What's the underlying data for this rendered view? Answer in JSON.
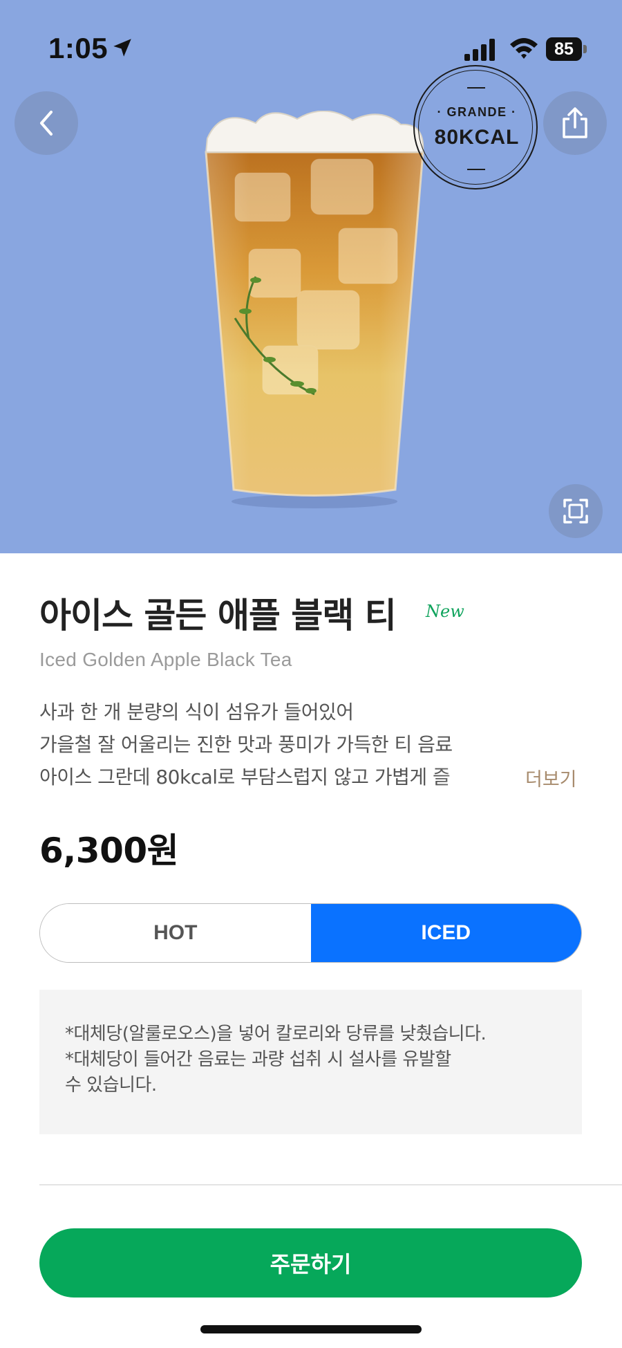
{
  "status_bar": {
    "time": "1:05",
    "battery": "85"
  },
  "hero": {
    "kcal_badge": {
      "size": "· GRANDE ·",
      "kcal": "80KCAL"
    },
    "background_color": "#89a6e0"
  },
  "product": {
    "name_ko": "아이스 골든 애플 블랙 티",
    "new_label": "New",
    "name_en": "Iced Golden Apple Black Tea",
    "description_lines": [
      "사과 한 개 분량의 식이 섬유가 들어있어",
      "가을철 잘 어울리는 진한 맛과 풍미가 가득한 티 음료",
      "아이스 그란데 80kcal로 부담스럽지 않고 가볍게 즐"
    ],
    "more_label": "더보기",
    "price": "6,300원"
  },
  "temperature": {
    "options": [
      "HOT",
      "ICED"
    ],
    "selected": "ICED",
    "selected_color": "#0a72ff"
  },
  "notice": {
    "lines": [
      "*대체당(알룰로오스)을 넣어 칼로리와 당류를 낮췄습니다.",
      "*대체당이 들어간 음료는 과량 섭취 시 설사를 유발할",
      "수 있습니다."
    ]
  },
  "actions": {
    "order_label": "주문하기",
    "order_color": "#06a85a"
  },
  "icons": [
    "location-arrow-icon",
    "signal-icon",
    "wifi-icon",
    "battery-icon",
    "back-chevron-icon",
    "share-icon",
    "expand-icon"
  ]
}
